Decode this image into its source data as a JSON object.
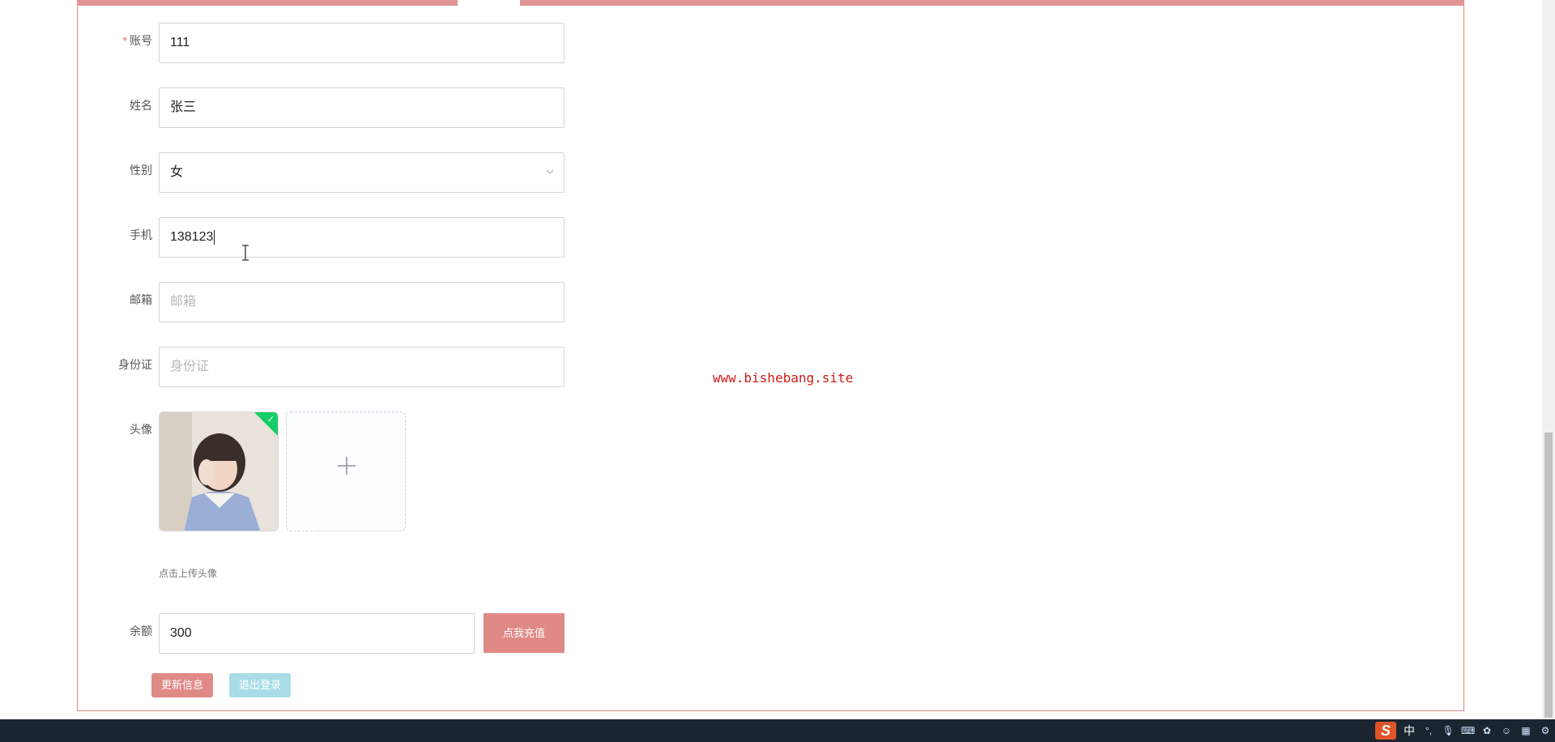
{
  "form": {
    "account": {
      "label": "账号",
      "required_mark": "*",
      "value": "111"
    },
    "name": {
      "label": "姓名",
      "value": "张三"
    },
    "gender": {
      "label": "性别",
      "value": "女"
    },
    "phone": {
      "label": "手机",
      "value": "138123"
    },
    "email": {
      "label": "邮箱",
      "placeholder": "邮箱"
    },
    "id_card": {
      "label": "身份证",
      "placeholder": "身份证"
    },
    "avatar": {
      "label": "头像",
      "hint": "点击上传头像"
    },
    "balance": {
      "label": "余额",
      "value": "300",
      "recharge_label": "点我充值"
    }
  },
  "actions": {
    "update_label": "更新信息",
    "logout_label": "退出登录"
  },
  "watermark": "www.bishebang.site",
  "taskbar": {
    "ime_chinese": "中"
  },
  "colors": {
    "accent": "#e08a87",
    "secondary": "#a8dde8",
    "border": "#dd8a8a",
    "success": "#13ce66",
    "watermark": "#d01818"
  }
}
